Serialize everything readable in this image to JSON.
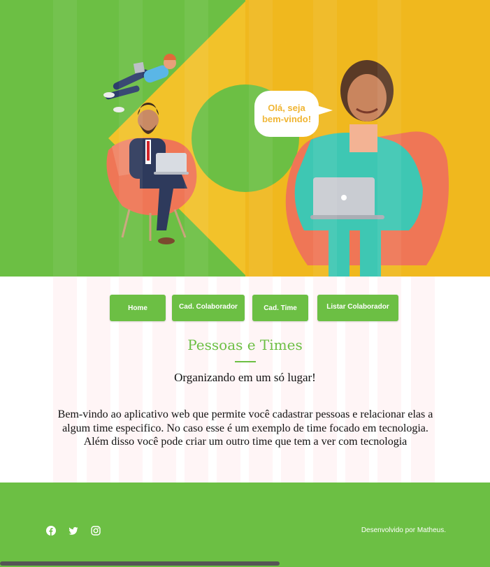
{
  "banner": {
    "speech_line1": "Olá, seja",
    "speech_line2": "bem-vindo!"
  },
  "nav": {
    "items": [
      {
        "label": "Home"
      },
      {
        "label": "Cad. Colaborador"
      },
      {
        "label": "Cad. Time"
      },
      {
        "label": "Listar Colaborador"
      }
    ]
  },
  "main": {
    "title": "Pessoas e Times",
    "subtitle": "Organizando em um só lugar!",
    "description": "Bem-vindo ao aplicativo web que permite você cadastrar pessoas e relacionar elas a algum time especifico. No caso esse é um exemplo de time focado em tecnologia. Além disso você pode criar um outro time que tem a ver com tecnologia"
  },
  "footer": {
    "social": [
      {
        "icon": "facebook-icon"
      },
      {
        "icon": "twitter-icon"
      },
      {
        "icon": "instagram-icon"
      }
    ],
    "credit": "Desenvolvido por Matheus."
  },
  "colors": {
    "green": "#6cbf44",
    "yellow": "#f0b81e",
    "chair": "#f0785a",
    "suit_teal": "#3ec7b3"
  }
}
